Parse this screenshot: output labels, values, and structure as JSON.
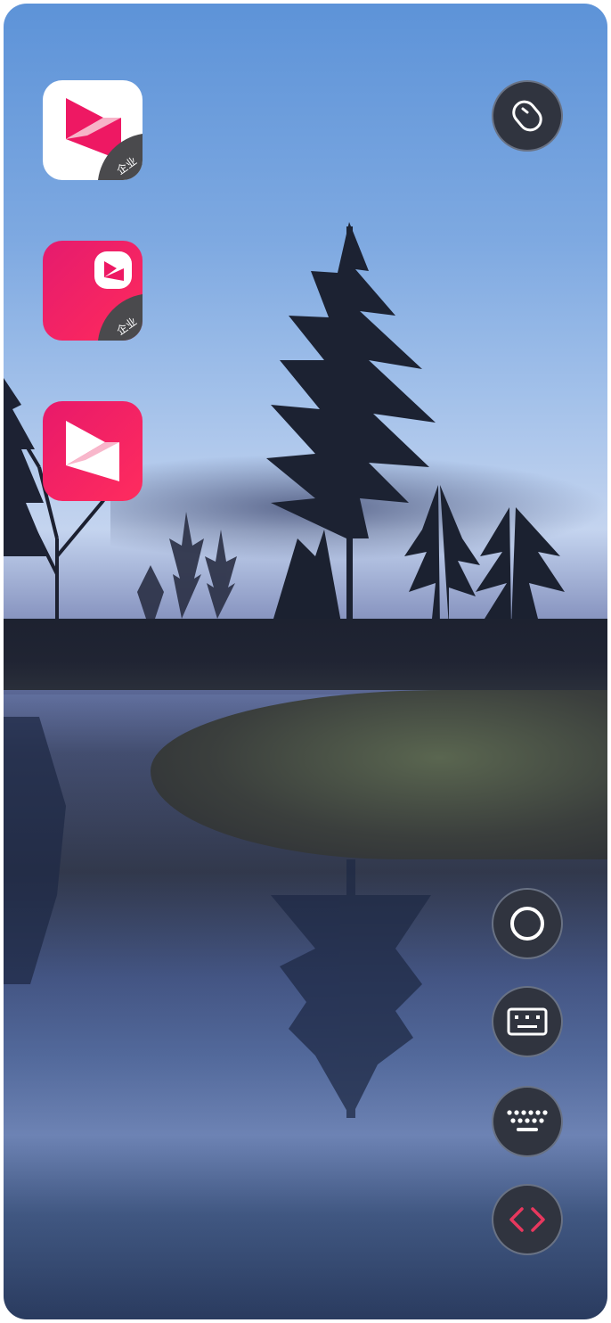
{
  "home": {
    "apps": [
      {
        "icon": "enterprise-media-app-icon",
        "badge": "企业"
      },
      {
        "icon": "enterprise-media-app-alt-icon",
        "badge": "企业"
      },
      {
        "icon": "media-app-icon"
      }
    ]
  },
  "floating_controls": {
    "top": {
      "icon": "mouse-icon"
    },
    "bottom": [
      {
        "icon": "home-circle-icon"
      },
      {
        "icon": "keyboard-panel-icon"
      },
      {
        "icon": "keyboard-icon"
      },
      {
        "icon": "code-brackets-icon"
      }
    ]
  },
  "colors": {
    "brand_pink": "#ee1863",
    "fab_bg": "#30343f",
    "code_accent": "#e8385e"
  }
}
